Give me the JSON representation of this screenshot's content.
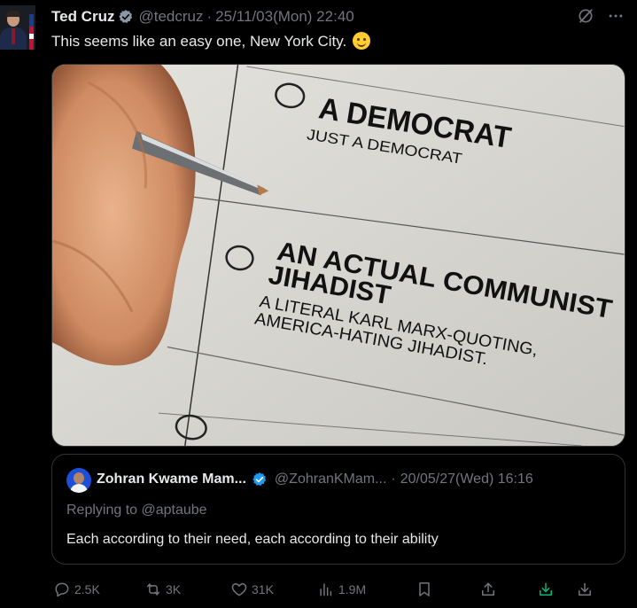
{
  "tweet": {
    "author_name": "Ted Cruz",
    "handle": "@tedcruz",
    "separator": "·",
    "time": "25/11/03(Mon) 22:40",
    "text": "This seems like an easy one, New York City.",
    "emoji": "melting-face",
    "more_label": "···"
  },
  "ballot": {
    "option1_title": "A DEMOCRAT",
    "option1_sub": "JUST A DEMOCRAT",
    "option2_title_line1": "AN ACTUAL COMMUNIST",
    "option2_title_line2": "JIHADIST",
    "option2_sub_line1": "A LITERAL KARL MARX-QUOTING,",
    "option2_sub_line2": "AMERICA-HATING JIHADIST."
  },
  "quote": {
    "author_name": "Zohran Kwame Mam...",
    "handle": "@ZohranKMam...",
    "separator": "·",
    "time": "20/05/27(Wed) 16:16",
    "reply_to": "Replying to @aptaube",
    "text": "Each according to their need, each according to their ability"
  },
  "actions": {
    "replies": "2.5K",
    "reposts": "3K",
    "likes": "31K",
    "views": "1.9M"
  },
  "colors": {
    "background": "#000000",
    "text_primary": "#e7e9ea",
    "text_secondary": "#71767b",
    "verified_blue": "#1d9bf0",
    "border": "#2f3336",
    "download_green": "#00ba7c"
  },
  "icons": [
    "verified-icon",
    "grok-icon",
    "more-icon",
    "reply-icon",
    "repost-icon",
    "like-icon",
    "views-icon",
    "bookmark-icon",
    "share-icon",
    "download-green-icon",
    "download-icon"
  ]
}
